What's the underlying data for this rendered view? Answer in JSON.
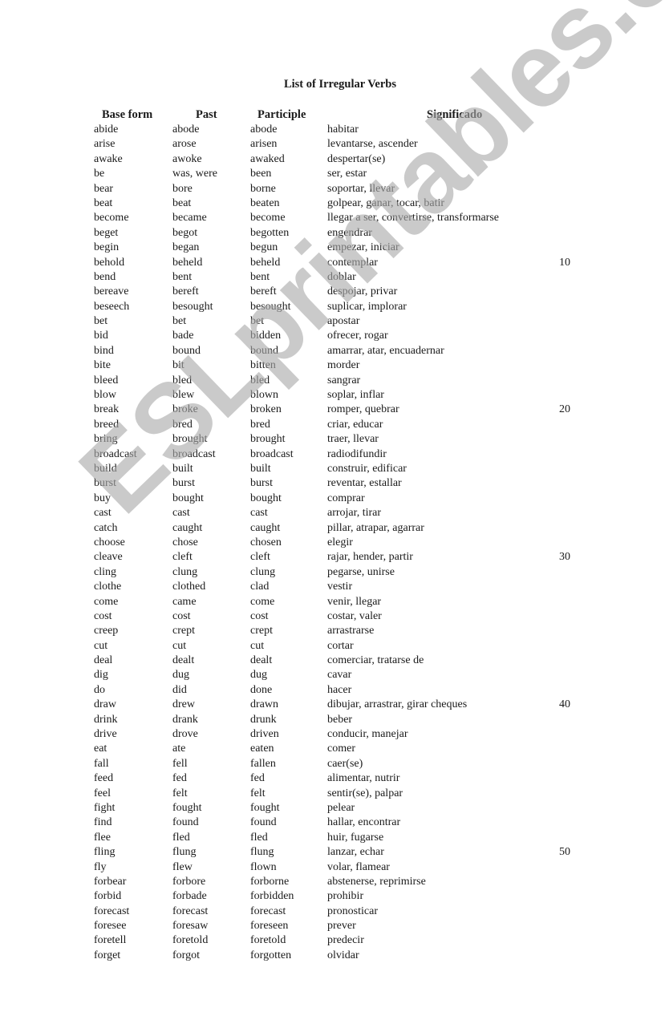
{
  "document": {
    "title": "List of Irregular Verbs",
    "columns": {
      "base": "Base form",
      "past": "Past",
      "participle": "Participle",
      "meaning": "Significado"
    },
    "watermark": "ESLprintables.com",
    "rows": [
      {
        "base": "abide",
        "past": "abode",
        "participle": "abode",
        "meaning": "habitar",
        "num": ""
      },
      {
        "base": "arise",
        "past": "arose",
        "participle": "arisen",
        "meaning": "levantarse, ascender",
        "num": ""
      },
      {
        "base": "awake",
        "past": "awoke",
        "participle": "awaked",
        "meaning": "despertar(se)",
        "num": ""
      },
      {
        "base": "be",
        "past": "was, were",
        "participle": "been",
        "meaning": "ser, estar",
        "num": ""
      },
      {
        "base": "bear",
        "past": "bore",
        "participle": "borne",
        "meaning": "soportar, llevar",
        "num": ""
      },
      {
        "base": "beat",
        "past": "beat",
        "participle": "beaten",
        "meaning": "golpear, ganar, tocar, batir",
        "num": ""
      },
      {
        "base": "become",
        "past": "became",
        "participle": "become",
        "meaning": "llegar a ser, convertirse, transformarse",
        "num": ""
      },
      {
        "base": "beget",
        "past": "begot",
        "participle": "begotten",
        "meaning": "engendrar",
        "num": ""
      },
      {
        "base": "begin",
        "past": "began",
        "participle": "begun",
        "meaning": "empezar, iniciar",
        "num": ""
      },
      {
        "base": "behold",
        "past": "beheld",
        "participle": "beheld",
        "meaning": "contemplar",
        "num": "10"
      },
      {
        "base": "bend",
        "past": "bent",
        "participle": "bent",
        "meaning": "doblar",
        "num": ""
      },
      {
        "base": "bereave",
        "past": "bereft",
        "participle": "bereft",
        "meaning": "despojar, privar",
        "num": ""
      },
      {
        "base": "beseech",
        "past": "besought",
        "participle": "besought",
        "meaning": "suplicar, implorar",
        "num": ""
      },
      {
        "base": "bet",
        "past": "bet",
        "participle": "bet",
        "meaning": "apostar",
        "num": ""
      },
      {
        "base": "bid",
        "past": "bade",
        "participle": "bidden",
        "meaning": "ofrecer, rogar",
        "num": ""
      },
      {
        "base": "bind",
        "past": "bound",
        "participle": "bound",
        "meaning": "amarrar, atar, encuadernar",
        "num": ""
      },
      {
        "base": "bite",
        "past": "bit",
        "participle": "bitten",
        "meaning": "morder",
        "num": ""
      },
      {
        "base": "bleed",
        "past": "bled",
        "participle": "bled",
        "meaning": "sangrar",
        "num": ""
      },
      {
        "base": "blow",
        "past": "blew",
        "participle": "blown",
        "meaning": "soplar, inflar",
        "num": ""
      },
      {
        "base": "break",
        "past": "broke",
        "participle": "broken",
        "meaning": "romper, quebrar",
        "num": "20"
      },
      {
        "base": "breed",
        "past": "bred",
        "participle": "bred",
        "meaning": "criar, educar",
        "num": ""
      },
      {
        "base": "bring",
        "past": "brought",
        "participle": "brought",
        "meaning": "traer, llevar",
        "num": ""
      },
      {
        "base": "broadcast",
        "past": "broadcast",
        "participle": "broadcast",
        "meaning": "radiodifundir",
        "num": ""
      },
      {
        "base": "build",
        "past": "built",
        "participle": "built",
        "meaning": "construir, edificar",
        "num": ""
      },
      {
        "base": "burst",
        "past": "burst",
        "participle": "burst",
        "meaning": "reventar, estallar",
        "num": ""
      },
      {
        "base": "buy",
        "past": "bought",
        "participle": "bought",
        "meaning": "comprar",
        "num": ""
      },
      {
        "base": "cast",
        "past": "cast",
        "participle": "cast",
        "meaning": "arrojar, tirar",
        "num": ""
      },
      {
        "base": "catch",
        "past": "caught",
        "participle": "caught",
        "meaning": "pillar, atrapar, agarrar",
        "num": ""
      },
      {
        "base": "choose",
        "past": "chose",
        "participle": "chosen",
        "meaning": "elegir",
        "num": ""
      },
      {
        "base": "cleave",
        "past": "cleft",
        "participle": "cleft",
        "meaning": "rajar, hender, partir",
        "num": "30"
      },
      {
        "base": "cling",
        "past": "clung",
        "participle": "clung",
        "meaning": "pegarse, unirse",
        "num": ""
      },
      {
        "base": "clothe",
        "past": "clothed",
        "participle": "clad",
        "meaning": "vestir",
        "num": ""
      },
      {
        "base": "come",
        "past": "came",
        "participle": "come",
        "meaning": "venir, llegar",
        "num": ""
      },
      {
        "base": "cost",
        "past": "cost",
        "participle": "cost",
        "meaning": "costar, valer",
        "num": ""
      },
      {
        "base": "creep",
        "past": "crept",
        "participle": "crept",
        "meaning": "arrastrarse",
        "num": ""
      },
      {
        "base": "cut",
        "past": "cut",
        "participle": "cut",
        "meaning": "cortar",
        "num": ""
      },
      {
        "base": "deal",
        "past": "dealt",
        "participle": "dealt",
        "meaning": "comerciar, tratarse de",
        "num": ""
      },
      {
        "base": "dig",
        "past": "dug",
        "participle": "dug",
        "meaning": "cavar",
        "num": ""
      },
      {
        "base": "do",
        "past": "did",
        "participle": "done",
        "meaning": "hacer",
        "num": ""
      },
      {
        "base": "draw",
        "past": "drew",
        "participle": "drawn",
        "meaning": "dibujar, arrastrar, girar cheques",
        "num": "40"
      },
      {
        "base": "drink",
        "past": "drank",
        "participle": "drunk",
        "meaning": "beber",
        "num": ""
      },
      {
        "base": "drive",
        "past": "drove",
        "participle": "driven",
        "meaning": "conducir, manejar",
        "num": ""
      },
      {
        "base": "eat",
        "past": "ate",
        "participle": "eaten",
        "meaning": "comer",
        "num": ""
      },
      {
        "base": "fall",
        "past": "fell",
        "participle": "fallen",
        "meaning": "caer(se)",
        "num": ""
      },
      {
        "base": "feed",
        "past": "fed",
        "participle": "fed",
        "meaning": "alimentar, nutrir",
        "num": ""
      },
      {
        "base": "feel",
        "past": "felt",
        "participle": "felt",
        "meaning": "sentir(se), palpar",
        "num": ""
      },
      {
        "base": "fight",
        "past": "fought",
        "participle": "fought",
        "meaning": "pelear",
        "num": ""
      },
      {
        "base": "find",
        "past": "found",
        "participle": "found",
        "meaning": "hallar, encontrar",
        "num": ""
      },
      {
        "base": "flee",
        "past": "fled",
        "participle": "fled",
        "meaning": "huir, fugarse",
        "num": ""
      },
      {
        "base": "fling",
        "past": "flung",
        "participle": "flung",
        "meaning": "lanzar, echar",
        "num": "50"
      },
      {
        "base": "fly",
        "past": "flew",
        "participle": "flown",
        "meaning": "volar, flamear",
        "num": ""
      },
      {
        "base": "forbear",
        "past": "forbore",
        "participle": "forborne",
        "meaning": "abstenerse, reprimirse",
        "num": ""
      },
      {
        "base": "forbid",
        "past": "forbade",
        "participle": "forbidden",
        "meaning": "prohibir",
        "num": ""
      },
      {
        "base": "forecast",
        "past": "forecast",
        "participle": "forecast",
        "meaning": "pronosticar",
        "num": ""
      },
      {
        "base": "foresee",
        "past": "foresaw",
        "participle": "foreseen",
        "meaning": "prever",
        "num": ""
      },
      {
        "base": "foretell",
        "past": "foretold",
        "participle": "foretold",
        "meaning": "predecir",
        "num": ""
      },
      {
        "base": "forget",
        "past": "forgot",
        "participle": "forgotten",
        "meaning": "olvidar",
        "num": ""
      }
    ]
  }
}
